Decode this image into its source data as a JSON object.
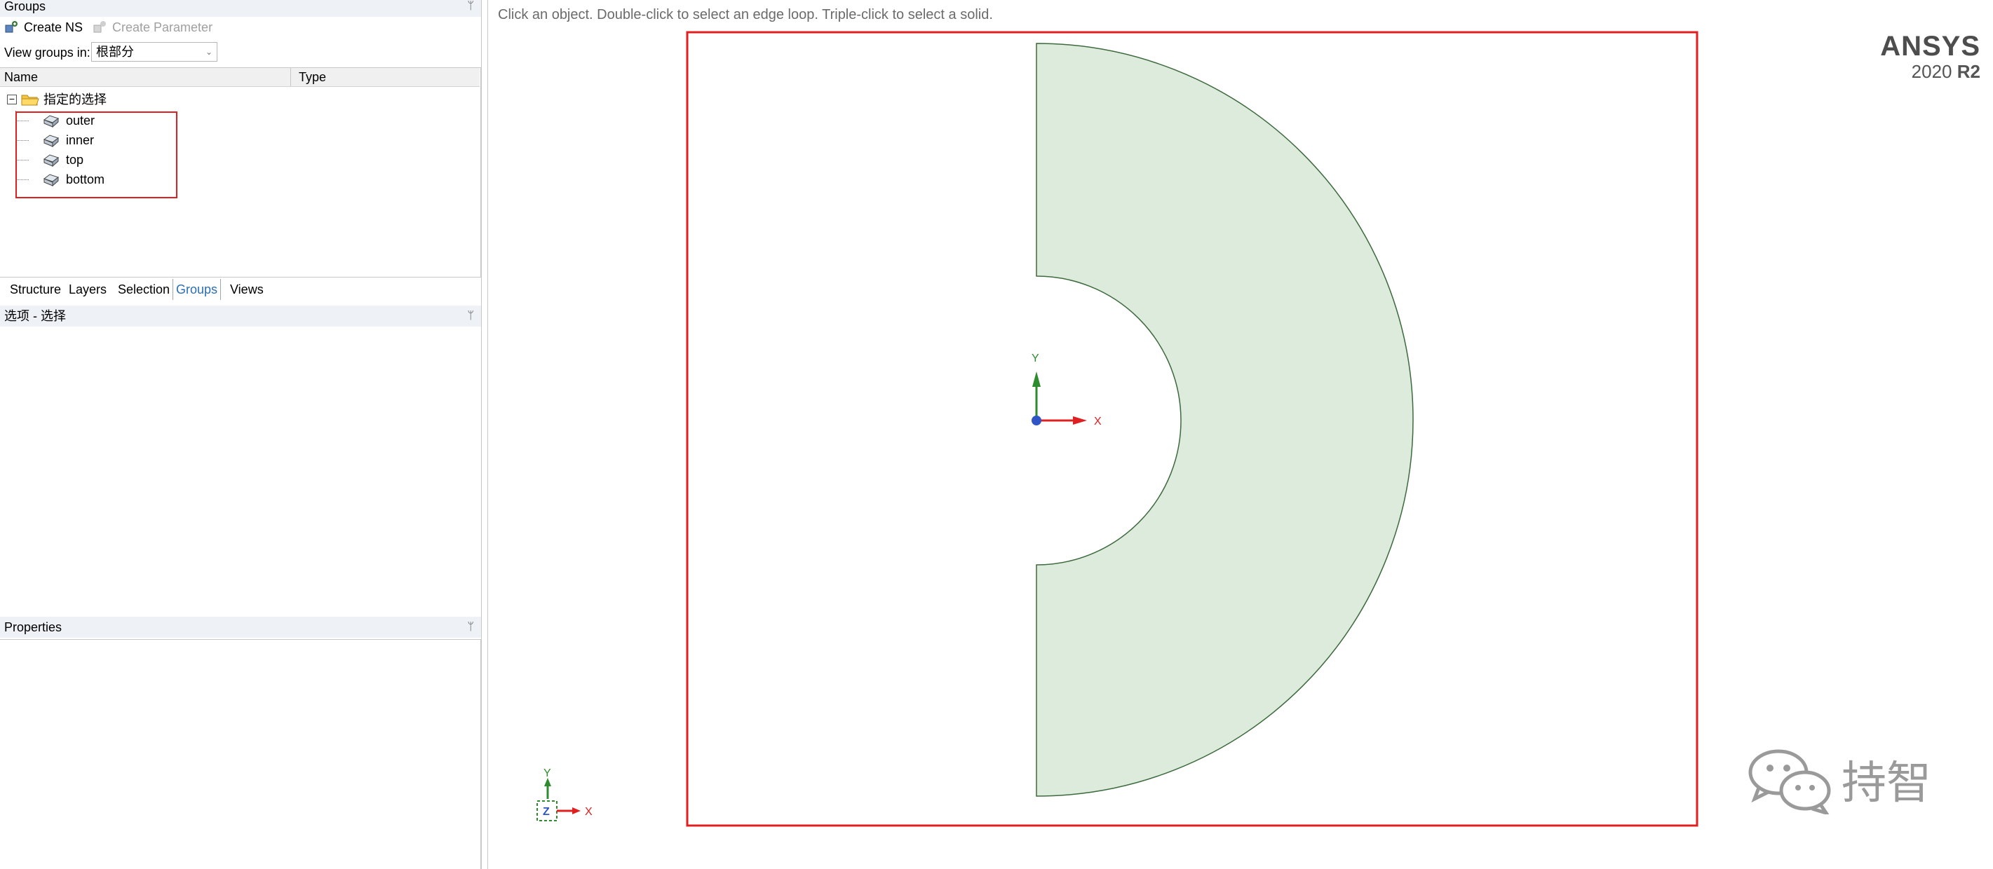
{
  "groups_panel": {
    "title": "Groups",
    "pin": "ᛘ",
    "create_ns": "Create NS",
    "create_parameter": "Create Parameter",
    "view_groups_label": "View groups in:",
    "view_groups_value": "根部分",
    "columns": {
      "name": "Name",
      "type": "Type"
    },
    "root": {
      "expander": "⊟",
      "label": "指定的选择"
    },
    "items": [
      {
        "label": "outer"
      },
      {
        "label": "inner"
      },
      {
        "label": "top"
      },
      {
        "label": "bottom"
      }
    ]
  },
  "tabs": [
    "Structure",
    "Layers",
    "Selection",
    "Groups",
    "Views"
  ],
  "active_tab": "Groups",
  "options_panel": {
    "title": "选项 - 选择"
  },
  "properties_panel": {
    "title": "Properties"
  },
  "viewport": {
    "hint": "Click an object. Double-click to select an edge loop. Triple-click to select a solid.",
    "brand_name": "ANSYS",
    "brand_version": "2020",
    "brand_release": "R2",
    "axis_labels": {
      "x": "X",
      "y": "Y",
      "z": "Z"
    },
    "shape_fill": "#dcebdc",
    "shape_stroke": "#3d6a3d",
    "selection_color": "#e02020",
    "watermark_text": "持智"
  }
}
